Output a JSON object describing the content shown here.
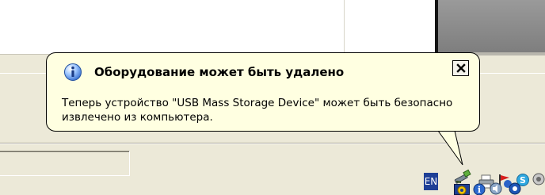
{
  "balloon": {
    "icon": "info-icon",
    "title": "Оборудование может быть удалено",
    "message": "Теперь устройство \"USB Mass Storage Device\" может быть безопасно извлечено из компьютера.",
    "close_icon": "close-icon"
  },
  "taskbar": {
    "language": "EN",
    "tray_icons": [
      "safely-remove-hardware-icon",
      "printer-icon",
      "flag-icon",
      "skype-icon",
      "extra-icon",
      "network-icon",
      "info-icon",
      "volume-icon",
      "pinned-icon"
    ]
  },
  "colors": {
    "balloon_background": "#ffffe1",
    "window_face": "#ece9d8",
    "language_bar": "#1e3f96"
  }
}
